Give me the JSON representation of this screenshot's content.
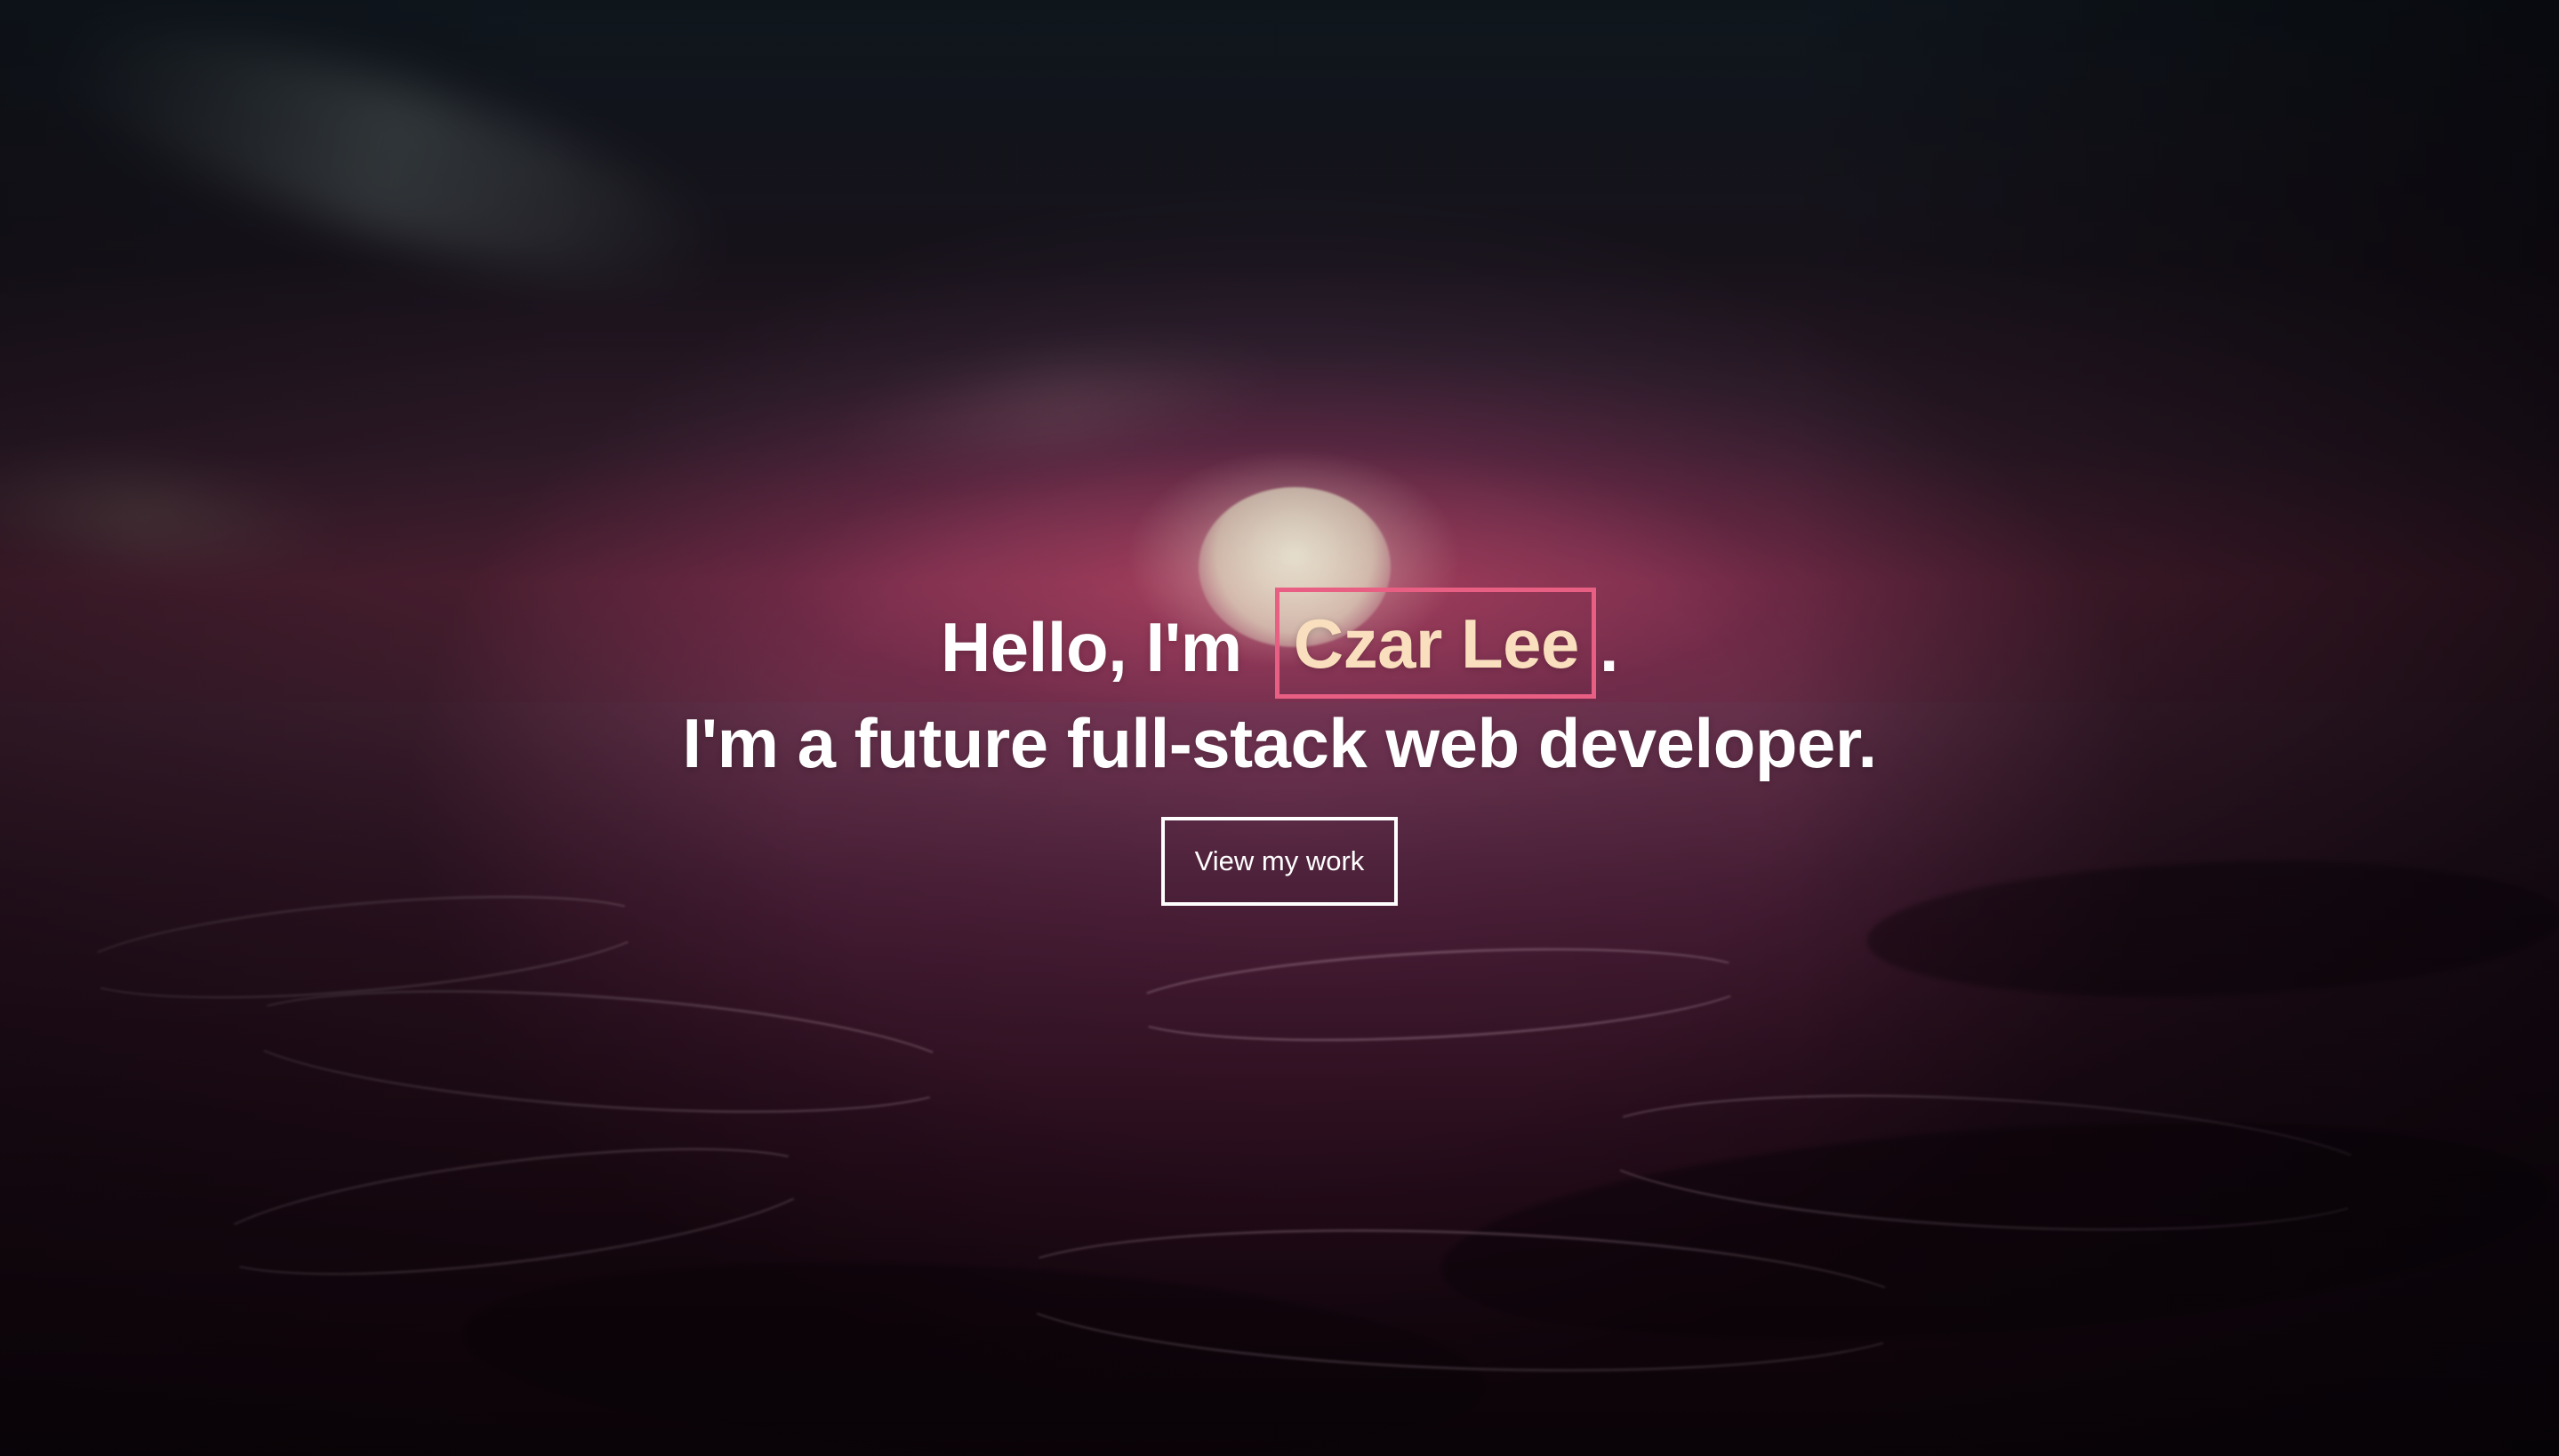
{
  "hero": {
    "greeting_prefix": "Hello, I'm",
    "name": "Czar Lee",
    "greeting_suffix": ".",
    "tagline": "I'm a future full-stack web developer.",
    "button_label": "View my work",
    "colors": {
      "name_text": "#f9dfbd",
      "name_border": "#e85f83",
      "text": "#ffffff"
    }
  },
  "icons": {
    "background": "sunset-ocean-background"
  }
}
